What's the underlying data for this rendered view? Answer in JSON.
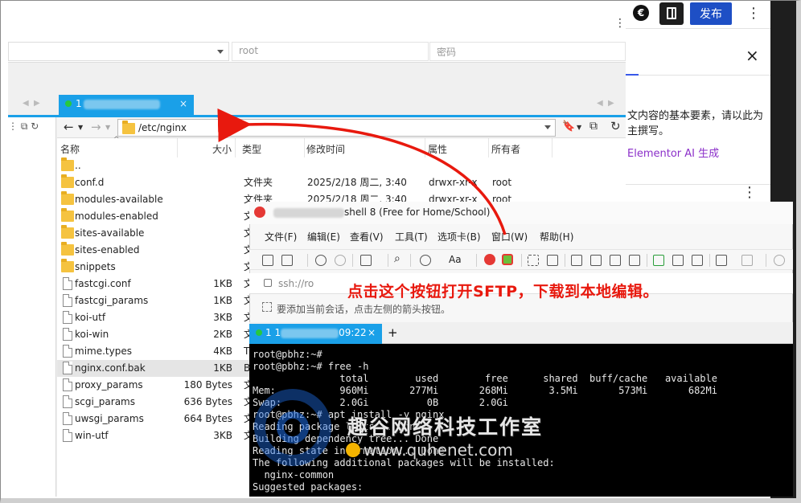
{
  "wordpress": {
    "elementor_icon": "€",
    "publish_label": "发布",
    "panel_text": "文内容的基本要素，请以此为主撰写。",
    "ai_link": "Elementor AI 生成",
    "close_icon": "×",
    "more_icon": "⋮"
  },
  "ftp": {
    "user_value": "root",
    "password_placeholder": "密码",
    "tab_prefix": "1",
    "tab_close": "×",
    "path": "/etc/nginx",
    "columns": {
      "name": "名称",
      "size": "大小",
      "type": "类型",
      "mtime": "修改时间",
      "perm": "属性",
      "owner": "所有者"
    },
    "files": [
      {
        "name": "..",
        "kind": "folder",
        "size": "",
        "type": "",
        "mtime": "",
        "perm": "",
        "owner": ""
      },
      {
        "name": "conf.d",
        "kind": "folder",
        "size": "",
        "type": "文件夹",
        "mtime": "2025/2/18 周二, 3:40",
        "perm": "drwxr-xr-x",
        "owner": "root"
      },
      {
        "name": "modules-available",
        "kind": "folder",
        "size": "",
        "type": "文件夹",
        "mtime": "2025/2/18 周二, 3:40",
        "perm": "drwxr-xr-x",
        "owner": "root"
      },
      {
        "name": "modules-enabled",
        "kind": "folder",
        "size": "",
        "type": "文",
        "mtime": "",
        "perm": "",
        "owner": ""
      },
      {
        "name": "sites-available",
        "kind": "folder",
        "size": "",
        "type": "文",
        "mtime": "",
        "perm": "",
        "owner": ""
      },
      {
        "name": "sites-enabled",
        "kind": "folder",
        "size": "",
        "type": "文",
        "mtime": "",
        "perm": "",
        "owner": ""
      },
      {
        "name": "snippets",
        "kind": "folder",
        "size": "",
        "type": "文",
        "mtime": "",
        "perm": "",
        "owner": ""
      },
      {
        "name": "fastcgi.conf",
        "kind": "doc",
        "size": "1KB",
        "type": "文",
        "mtime": "",
        "perm": "",
        "owner": ""
      },
      {
        "name": "fastcgi_params",
        "kind": "doc",
        "size": "1KB",
        "type": "文",
        "mtime": "",
        "perm": "",
        "owner": ""
      },
      {
        "name": "koi-utf",
        "kind": "doc",
        "size": "3KB",
        "type": "文",
        "mtime": "",
        "perm": "",
        "owner": ""
      },
      {
        "name": "koi-win",
        "kind": "doc",
        "size": "2KB",
        "type": "文",
        "mtime": "",
        "perm": "",
        "owner": ""
      },
      {
        "name": "mime.types",
        "kind": "doc",
        "size": "4KB",
        "type": "T",
        "mtime": "",
        "perm": "",
        "owner": ""
      },
      {
        "name": "nginx.conf.bak",
        "kind": "doc",
        "size": "1KB",
        "type": "B",
        "mtime": "",
        "perm": "",
        "owner": ""
      },
      {
        "name": "proxy_params",
        "kind": "doc",
        "size": "180 Bytes",
        "type": "文",
        "mtime": "",
        "perm": "",
        "owner": ""
      },
      {
        "name": "scgi_params",
        "kind": "doc",
        "size": "636 Bytes",
        "type": "文",
        "mtime": "",
        "perm": "",
        "owner": ""
      },
      {
        "name": "uwsgi_params",
        "kind": "doc",
        "size": "664 Bytes",
        "type": "文",
        "mtime": "",
        "perm": "",
        "owner": ""
      },
      {
        "name": "win-utf",
        "kind": "doc",
        "size": "3KB",
        "type": "文",
        "mtime": "",
        "perm": "",
        "owner": ""
      }
    ]
  },
  "xshell": {
    "title_suffix": "shell 8 (Free for Home/School)",
    "menu": [
      "文件(F)",
      "编辑(E)",
      "查看(V)",
      "工具(T)",
      "选项卡(B)",
      "窗口(W)",
      "帮助(H)"
    ],
    "address": "ssh://ro",
    "hint": "要添加当前会话，点击左侧的箭头按钮。",
    "tab_label": "1 1",
    "tab_time": "09:22",
    "tab_close": "×",
    "new_tab": "+",
    "terminal": "root@pbhz:~#\nroot@pbhz:~# free -h\n               total        used        free      shared  buff/cache   available\nMem:           960Mi       277Mi       268Mi       3.5Mi       573Mi       682Mi\nSwap:          2.0Gi          0B       2.0Gi\nroot@pbhz:~# apt install -y nginx\nReading package lists... Done\nBuilding dependency tree... Done\nReading state information... Done\nThe following additional packages will be installed:\n  nginx-common\nSuggested packages:"
  },
  "annotation": "点击这个按钮打开SFTP，下载到本地编辑。",
  "watermark": {
    "name": "趣谷网络科技工作室",
    "url": "www.quhenet.com"
  },
  "colors": {
    "accent": "#1aa0e8",
    "annotation": "#e8190e",
    "publish": "#1e4fc5"
  }
}
